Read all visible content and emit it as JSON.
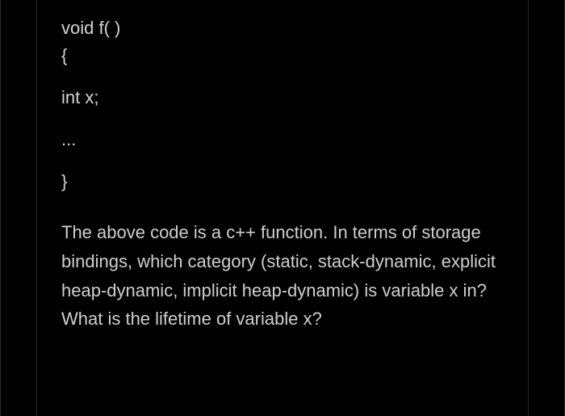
{
  "code": {
    "line1": "void f( )",
    "line2": "{",
    "line3": "int x;",
    "line4": "...",
    "line5": "}"
  },
  "question": "The above code is a c++ function. In terms of storage bindings, which category (static, stack-dynamic, explicit heap-dynamic, implicit heap-dynamic) is variable x in? What is the lifetime of variable x?"
}
